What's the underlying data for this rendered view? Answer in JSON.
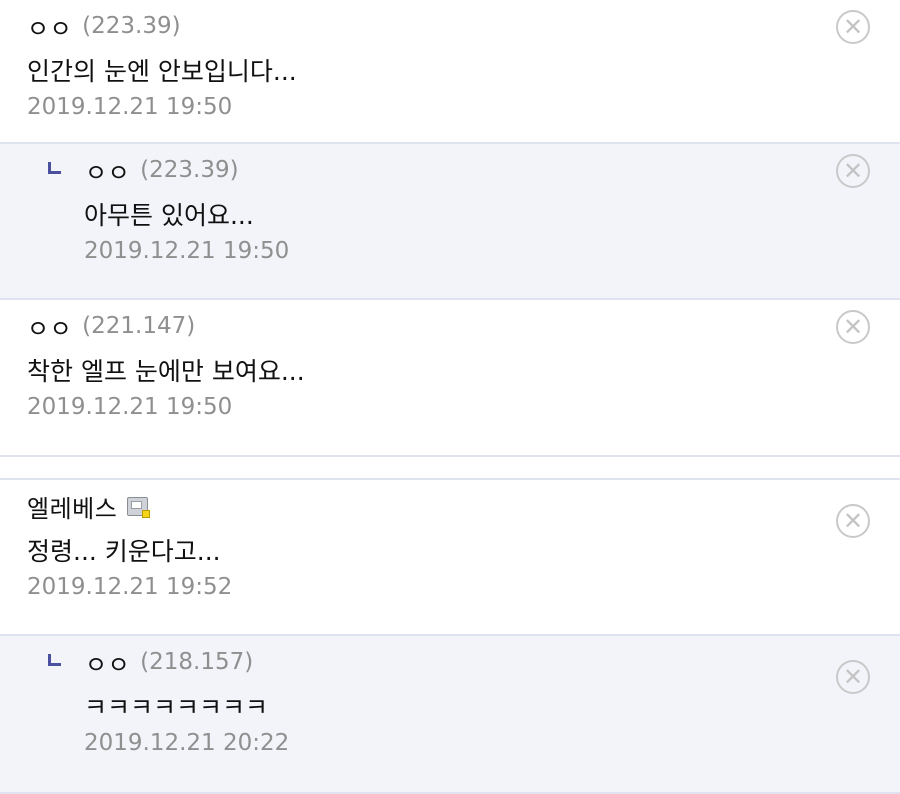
{
  "comments": [
    {
      "nick": "ㅇㅇ",
      "ip": "(223.39)",
      "text": "인간의 눈엔 안보입니다...",
      "date": "2019.12.21 19:50",
      "delete_icon": "close-circle-icon"
    },
    {
      "nick": "ㅇㅇ",
      "ip": "(223.39)",
      "text": "아무튼 있어요...",
      "date": "2019.12.21 19:50",
      "delete_icon": "close-circle-icon"
    },
    {
      "nick": "ㅇㅇ",
      "ip": "(221.147)",
      "text": "착한 엘프 눈에만 보여요...",
      "date": "2019.12.21 19:50",
      "delete_icon": "close-circle-icon"
    },
    {
      "nick": "엘레베스",
      "text": "정령... 키운다고...",
      "date": "2019.12.21 19:52",
      "delete_icon": "close-circle-icon",
      "badge_icon": "gallog-icon"
    },
    {
      "nick": "ㅇㅇ",
      "ip": "(218.157)",
      "text": "ㅋㅋㅋㅋㅋㅋㅋㅋ",
      "date": "2019.12.21 20:22",
      "delete_icon": "close-circle-icon"
    }
  ],
  "colors": {
    "reply_background": "#f3f4fa",
    "divider": "#dfe3ef",
    "reply_marker": "#4a4f9e",
    "meta_text": "#8f8f8f"
  }
}
